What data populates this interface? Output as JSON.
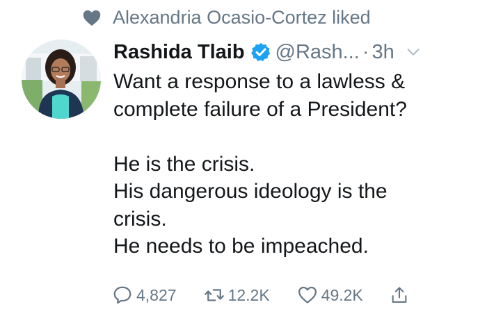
{
  "social_context": {
    "icon": "heart-icon",
    "text": "Alexandria Ocasio-Cortez liked"
  },
  "tweet": {
    "author_name": "Rashida Tlaib",
    "verified_icon": "verified-badge-icon",
    "handle": "@Rash...",
    "separator": "·",
    "time": "3h",
    "lines": [
      "Want a response to a lawless &",
      "complete failure of a President?",
      "",
      "He is the crisis.",
      "His dangerous ideology is the",
      "crisis.",
      "He needs to be impeached."
    ]
  },
  "actions": {
    "reply_count": "4,827",
    "retweet_count": "12.2K",
    "like_count": "49.2K"
  },
  "colors": {
    "text": "#14171a",
    "secondary": "#657786",
    "verified": "#1da1f2"
  }
}
